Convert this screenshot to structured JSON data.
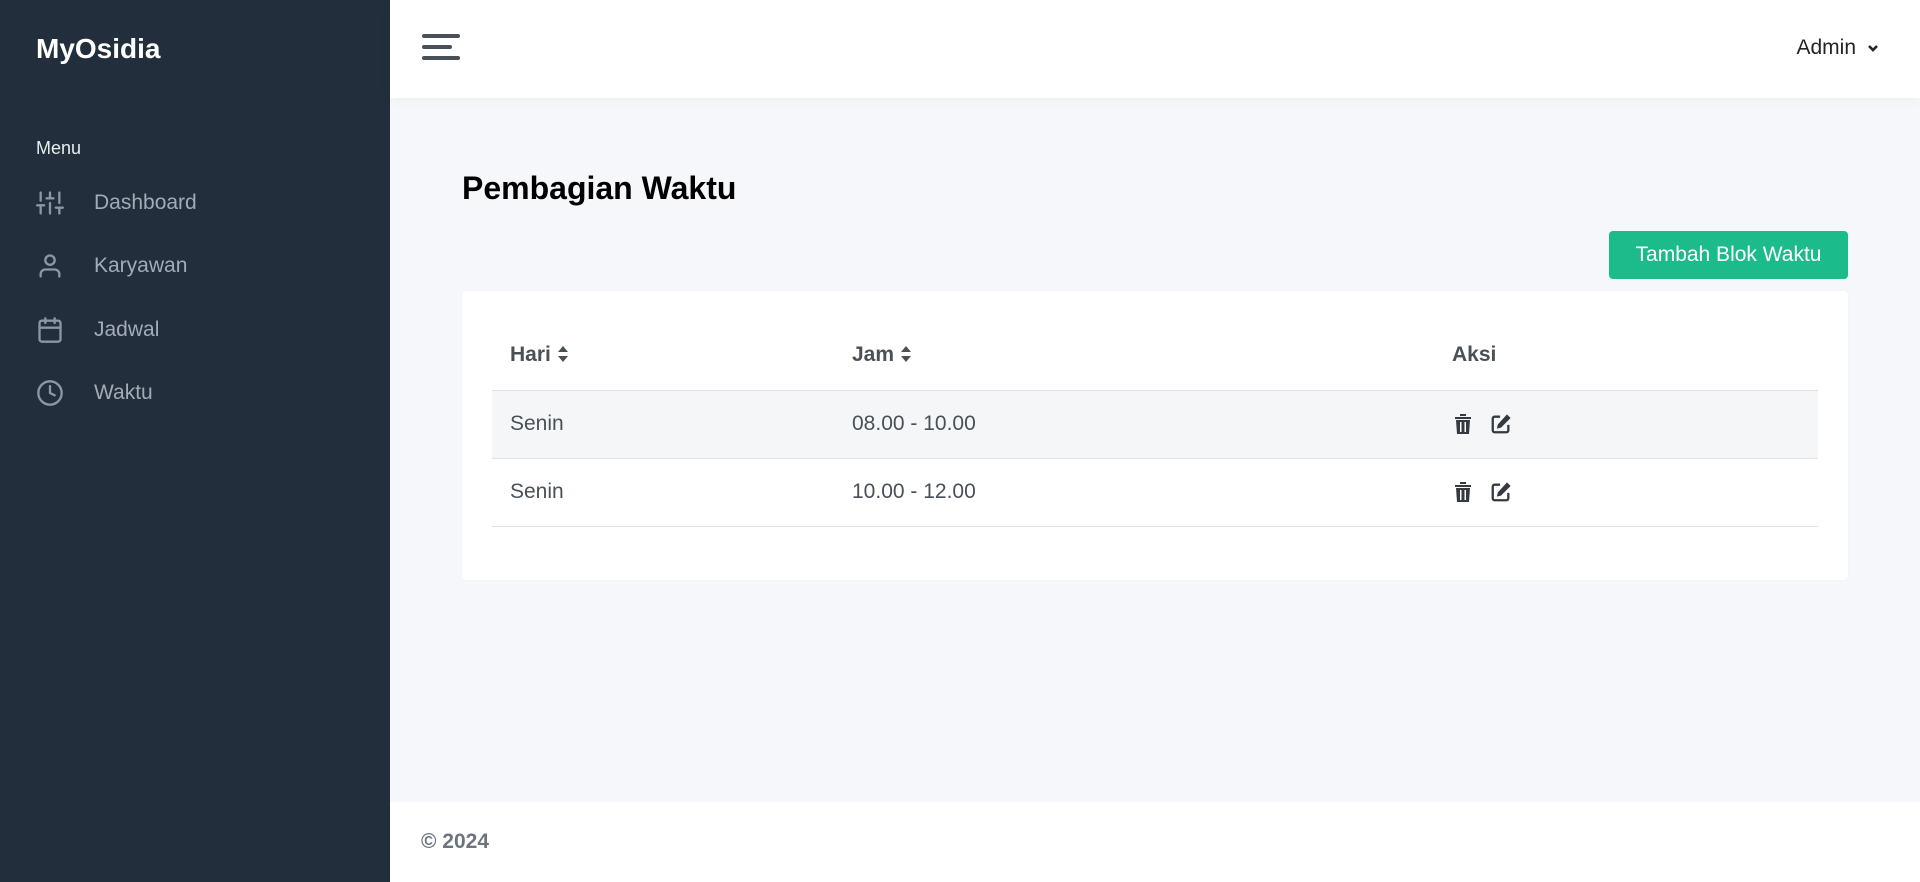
{
  "sidebar": {
    "brand": "MyOsidia",
    "menu_heading": "Menu",
    "items": [
      {
        "label": "Dashboard",
        "icon": "sliders-icon"
      },
      {
        "label": "Karyawan",
        "icon": "user-icon"
      },
      {
        "label": "Jadwal",
        "icon": "calendar-icon"
      },
      {
        "label": "Waktu",
        "icon": "clock-icon"
      }
    ]
  },
  "header": {
    "user_name": "Admin"
  },
  "main": {
    "title": "Pembagian Waktu",
    "add_button_label": "Tambah Blok Waktu",
    "table": {
      "columns": [
        "Hari",
        "Jam",
        "Aksi"
      ],
      "rows": [
        {
          "hari": "Senin",
          "jam": "08.00 - 10.00"
        },
        {
          "hari": "Senin",
          "jam": "10.00 - 12.00"
        }
      ]
    }
  },
  "footer": {
    "copyright": "© 2024"
  },
  "colors": {
    "sidebar_bg": "#222e3c",
    "accent": "#1cbb8c",
    "page_bg": "#f5f7fa"
  }
}
